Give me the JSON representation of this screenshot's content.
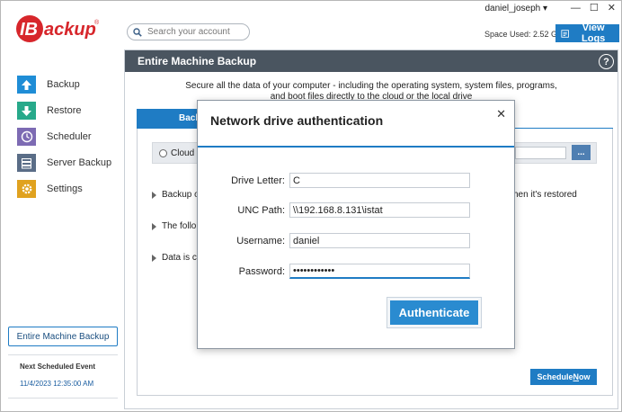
{
  "window": {
    "user": "daniel_joseph",
    "controls": {
      "minimize": "—",
      "maximize": "☐",
      "close": "✕"
    }
  },
  "header": {
    "logo_text": "IBackup",
    "search_placeholder": "Search your account",
    "space_used": "Space Used: 2.52 GB",
    "view_logs": "View Logs"
  },
  "sidebar": {
    "items": [
      {
        "label": "Backup",
        "icon": "arrow-up-icon"
      },
      {
        "label": "Restore",
        "icon": "arrow-down-icon"
      },
      {
        "label": "Scheduler",
        "icon": "clock-icon"
      },
      {
        "label": "Server Backup",
        "icon": "server-icon"
      },
      {
        "label": "Settings",
        "icon": "gear-icon"
      }
    ],
    "machine_button": "Entire Machine Backup",
    "next_scheduled_label": "Next Scheduled Event",
    "next_scheduled_value": "11/4/2023 12:35:00 AM"
  },
  "panel": {
    "title": "Entire Machine Backup",
    "description_line1": "Secure all the data of your computer - including the operating system, system files, programs,",
    "description_line2": "and boot files directly to the cloud or the local drive",
    "tab_label": "Backup",
    "destination_label": "Cloud B",
    "bullets": [
      "Backup o",
      "The follo",
      "Data is c"
    ],
    "bullet1_tail": "hen it's restored",
    "browse_label": "...",
    "schedule_now_prefix": "Schedule ",
    "schedule_now_accel": "N",
    "schedule_now_suffix": "ow"
  },
  "modal": {
    "title": "Network drive authentication",
    "close": "✕",
    "fields": {
      "drive_letter": {
        "label": "Drive Letter:",
        "value": "C"
      },
      "unc_path": {
        "label": "UNC Path:",
        "value": "\\\\192.168.8.131\\istat"
      },
      "username": {
        "label": "Username:",
        "value": "daniel"
      },
      "password": {
        "label": "Password:",
        "value": "••••••••••••"
      }
    },
    "authenticate": "Authenticate"
  },
  "colors": {
    "accent": "#1f7cc4",
    "header_bar": "#4a5560",
    "logo_red": "#d7262b"
  }
}
